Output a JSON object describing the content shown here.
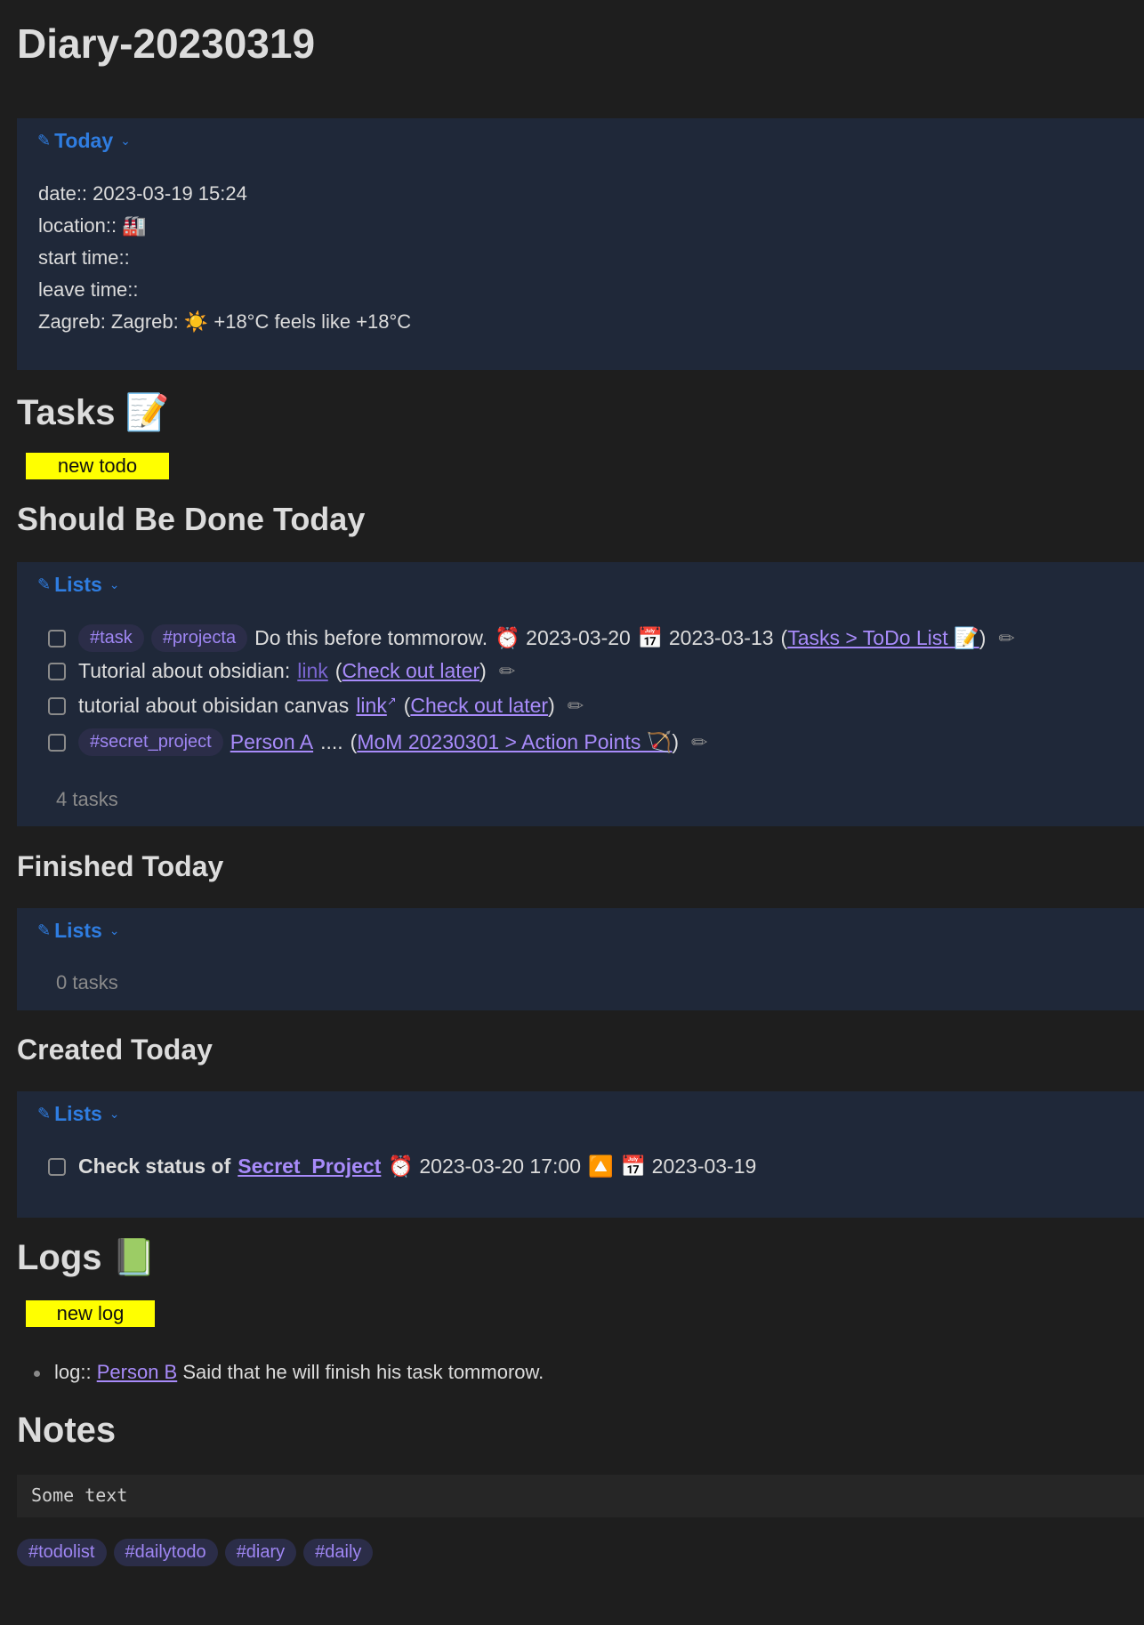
{
  "title": "Diary-20230319",
  "today_callout": {
    "title": "Today",
    "lines": [
      "date:: 2023-03-19 15:24",
      "location:: 🏭",
      "start time::",
      "leave time::",
      "Zagreb: Zagreb: ☀️ +18°C feels like +18°C"
    ]
  },
  "tasks_heading": "Tasks 📝",
  "new_todo_label": "new todo",
  "should_heading": "Should Be Done Today",
  "should_callout": {
    "title": "Lists",
    "tasks": [
      {
        "tags": [
          "#task",
          "#projecta"
        ],
        "text": "Do this before tommorow.",
        "due": "⏰ 2023-03-20",
        "sched": "📅 2023-03-13",
        "link": "Tasks > ToDo List 📝"
      },
      {
        "text": "Tutorial about obsidian:",
        "inline_link": "link",
        "link": "Check out later"
      },
      {
        "text": "tutorial about obisidan canvas",
        "inline_link": "link",
        "link": "Check out later"
      },
      {
        "tags": [
          "#secret_project"
        ],
        "person": "Person A",
        "text": "....",
        "link": "MoM 20230301 > Action Points 🏹"
      }
    ],
    "count": "4 tasks"
  },
  "finished_heading": "Finished Today",
  "finished_callout": {
    "title": "Lists",
    "count": "0 tasks"
  },
  "created_heading": "Created Today",
  "created_callout": {
    "title": "Lists",
    "task": {
      "prefix": "Check status of",
      "link": "Secret_Project",
      "due": "⏰ 2023-03-20 17:00",
      "priority": "🔼",
      "created": "📅 2023-03-19"
    }
  },
  "logs_heading": "Logs 📗",
  "new_log_label": "new log",
  "log": {
    "prefix": "log::",
    "person": "Person B",
    "text": "Said that he will finish his task tommorow."
  },
  "notes_heading": "Notes",
  "notes_text": "Some text",
  "footer_tags": [
    "#todolist",
    "#dailytodo",
    "#diary",
    "#daily"
  ]
}
